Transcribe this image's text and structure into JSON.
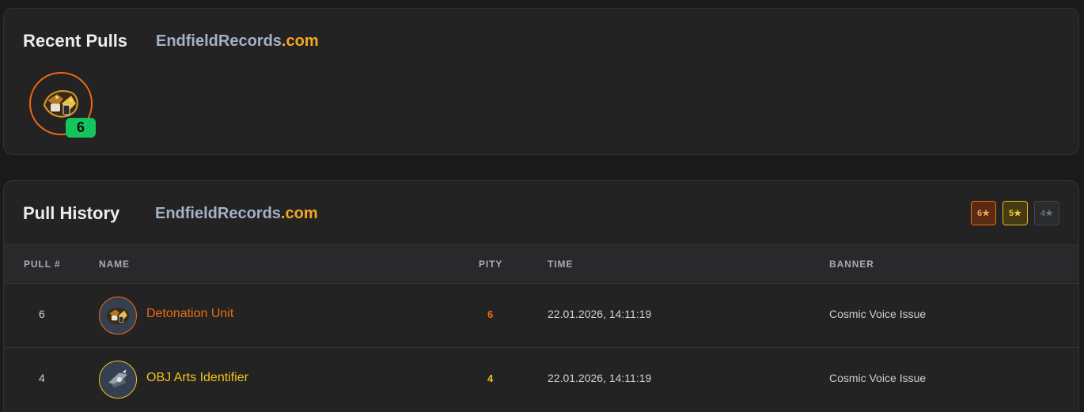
{
  "recent": {
    "title": "Recent Pulls",
    "brand_name": "EndfieldRecords",
    "brand_tld": ".com",
    "pulls": [
      {
        "item": "Detonation Unit",
        "rarity": 6,
        "pity": "6",
        "icon": "detonation-unit-icon"
      }
    ]
  },
  "history": {
    "title": "Pull History",
    "brand_name": "EndfieldRecords",
    "brand_tld": ".com",
    "filters": [
      "6★",
      "5★",
      "4★"
    ],
    "columns": [
      "PULL #",
      "NAME",
      "PITY",
      "TIME",
      "BANNER"
    ],
    "rows": [
      {
        "pull": "6",
        "name": "Detonation Unit",
        "rarity": 6,
        "pity": "6",
        "time": "22.01.2026, 14:11:19",
        "banner": "Cosmic Voice Issue",
        "icon": "detonation-unit-icon"
      },
      {
        "pull": "4",
        "name": "OBJ Arts Identifier",
        "rarity": 5,
        "pity": "4",
        "time": "22.01.2026, 14:11:19",
        "banner": "Cosmic Voice Issue",
        "icon": "obj-arts-identifier-icon"
      }
    ]
  },
  "colors": {
    "background": "#1a1a1b",
    "card": "#232324",
    "rarity_6": "#f06a12",
    "rarity_5": "#f2c21b",
    "pity_badge": "#16c45d",
    "brand_accent": "#f5a623"
  }
}
